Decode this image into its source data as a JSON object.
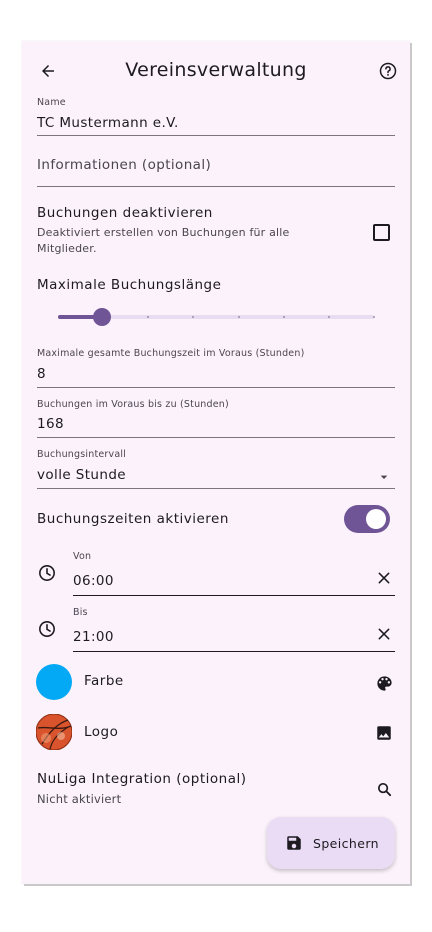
{
  "app_bar": {
    "title": "Vereinsverwaltung",
    "back_icon": "arrow-back-icon",
    "help_icon": "help-circle-icon"
  },
  "name_field": {
    "label": "Name",
    "value": "TC Mustermann e.V."
  },
  "info_field": {
    "placeholder": "Informationen (optional)"
  },
  "bookings_disable": {
    "title": "Buchungen deaktivieren",
    "subtitle": "Deaktiviert erstellen von Buchungen für alle Mitglieder.",
    "checked": false
  },
  "max_booking_length": {
    "title": "Maximale Buchungslänge",
    "slider_fraction": 0.14,
    "tick_count": 7
  },
  "total_time_field": {
    "label": "Maximale gesamte Buchungszeit im Voraus (Stunden)",
    "value": "8"
  },
  "advance_field": {
    "label": "Buchungen im Voraus bis zu (Stunden)",
    "value": "168"
  },
  "interval_field": {
    "label": "Buchungsintervall",
    "value": "volle Stunde"
  },
  "booking_times": {
    "label": "Buchungszeiten aktivieren",
    "enabled": true
  },
  "from_field": {
    "label": "Von",
    "value": "06:00"
  },
  "to_field": {
    "label": "Bis",
    "value": "21:00"
  },
  "color_row": {
    "label": "Farbe",
    "color": "#03a9f4",
    "icon": "palette-icon"
  },
  "logo_row": {
    "label": "Logo",
    "icon": "image-icon"
  },
  "nuliga": {
    "title": "NuLiga Integration (optional)",
    "subtitle": "Nicht aktiviert",
    "icon": "search-icon"
  },
  "save_button": {
    "label": "Speichern",
    "icon": "save-icon"
  },
  "colors": {
    "background": "#fcf2fb",
    "accent": "#6f5596",
    "fab": "#ebdcf6"
  }
}
